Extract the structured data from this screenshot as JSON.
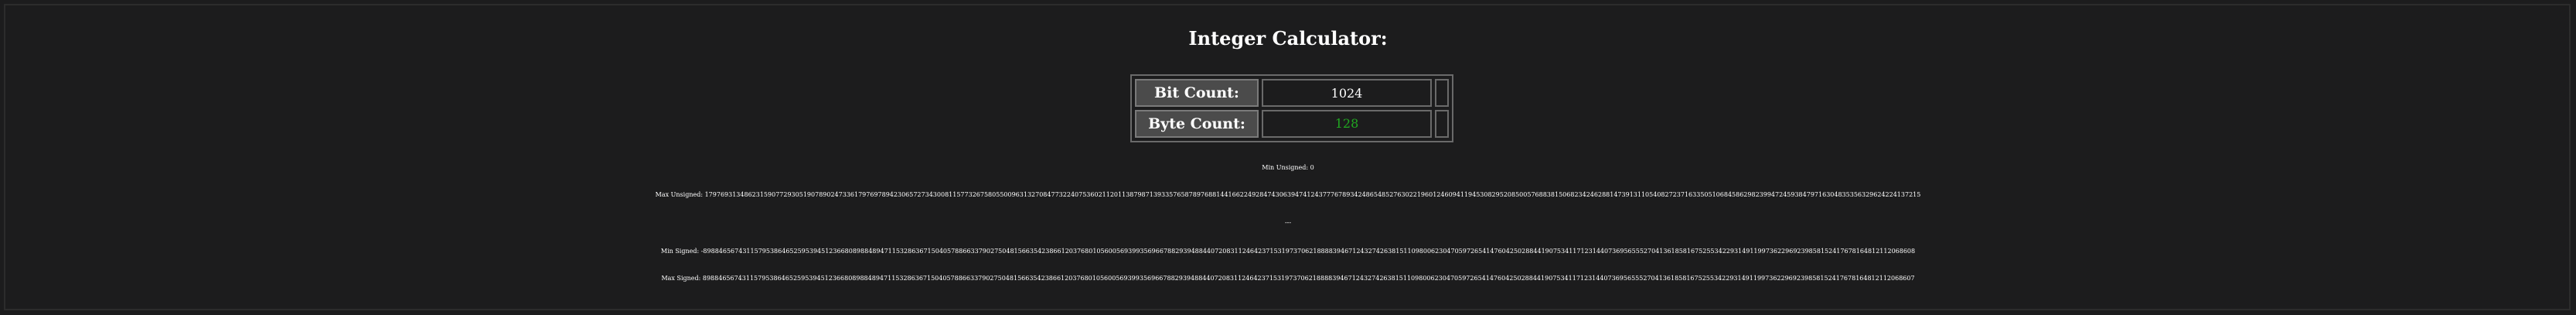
{
  "title": "Integer Calculator:",
  "inputs": {
    "bit_count_label": "Bit Count:",
    "bit_count_value": "1024",
    "byte_count_label": "Byte Count:",
    "byte_count_value": "128"
  },
  "results": {
    "min_unsigned": "Min Unsigned: 0",
    "max_unsigned": "Max Unsigned: 179769313486231590772930519078902473361797697894230657273430081157732675805500963132708477322407536021120113879871393357658789768814416622492847430639474124377767893424865485276302219601246094119453082952085005768838150682342462881473913110540827237163350510684586298239947245938479716304835356329624224137215",
    "divider": "---",
    "min_signed": "Min Signed: -89884656743115795386465259539451236680898848947115328636715040578866337902750481566354238661203768010560056939935696678829394884407208311246423715319737062188883946712432742638151109800623047059726541476042502884419075341171231440736956555270413618581675255342293149119973622969239858152417678164812112068608",
    "max_signed": "Max Signed: 89884656743115795386465259539451236680898848947115328636715040578866337902750481566354238661203768010560056939935696678829394884407208311246423715319737062188883946712432742638151109800623047059726541476042502884419075341171231440736956555270413618581675255342293149119973622969239858152417678164812112068607"
  },
  "colors": {
    "background": "#1c1c1d",
    "text": "#ffffff",
    "label_cell": "#4b4b4b",
    "byte_count_text": "#21a821"
  }
}
